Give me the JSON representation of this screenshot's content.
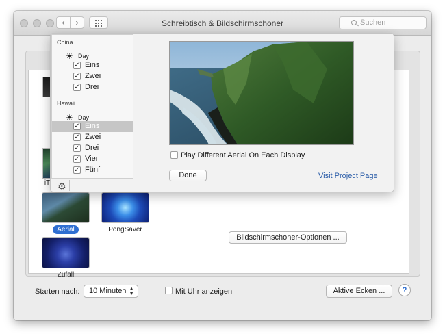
{
  "window": {
    "title": "Schreibtisch & Bildschirmschoner",
    "search_placeholder": "Suchen"
  },
  "savers": [
    {
      "name": "Aerial",
      "selected": true
    },
    {
      "name": "PongSaver",
      "selected": false
    },
    {
      "name": "Zufall",
      "selected": false
    },
    {
      "name": "iT",
      "selected": false
    }
  ],
  "options_button": "Bildschirmschoner-Optionen ...",
  "bottom": {
    "start_label": "Starten nach:",
    "start_value": "10 Minuten",
    "clock_label": "Mit Uhr anzeigen",
    "clock_checked": false,
    "corners_button": "Aktive Ecken ...",
    "help": "?"
  },
  "popover": {
    "groups": [
      {
        "title": "China",
        "time": "Day",
        "items": [
          {
            "label": "Eins",
            "checked": true
          },
          {
            "label": "Zwei",
            "checked": true
          },
          {
            "label": "Drei",
            "checked": true
          }
        ]
      },
      {
        "title": "Hawaii",
        "time": "Day",
        "items": [
          {
            "label": "Eins",
            "checked": true,
            "selected": true
          },
          {
            "label": "Zwei",
            "checked": true
          },
          {
            "label": "Drei",
            "checked": true
          },
          {
            "label": "Vier",
            "checked": true
          },
          {
            "label": "Fünf",
            "checked": true
          }
        ]
      }
    ],
    "play_different_label": "Play Different Aerial On Each Display",
    "play_different_checked": false,
    "done_button": "Done",
    "project_link": "Visit Project Page"
  }
}
